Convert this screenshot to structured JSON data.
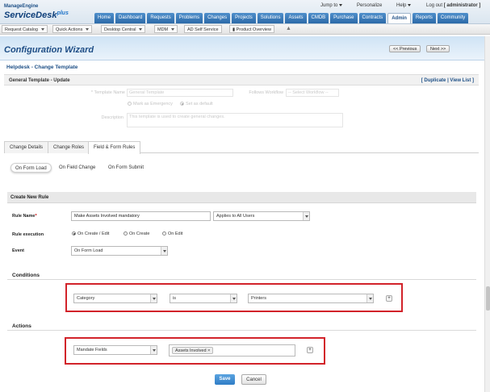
{
  "header": {
    "logo_top": "ManageEngine",
    "logo_main": "ServiceDesk",
    "logo_suffix": "plus",
    "links": {
      "jump_to": "Jump to",
      "personalize": "Personalize",
      "help": "Help",
      "logout": "Log out",
      "user": "[ administrator ]"
    },
    "nav": [
      {
        "label": "Home"
      },
      {
        "label": "Dashboard"
      },
      {
        "label": "Requests"
      },
      {
        "label": "Problems"
      },
      {
        "label": "Changes"
      },
      {
        "label": "Projects"
      },
      {
        "label": "Solutions"
      },
      {
        "label": "Assets"
      },
      {
        "label": "CMDB"
      },
      {
        "label": "Purchase"
      },
      {
        "label": "Contracts"
      },
      {
        "label": "Admin",
        "active": true
      },
      {
        "label": "Reports"
      },
      {
        "label": "Community"
      }
    ]
  },
  "toolbar": {
    "request_catalog": "Request Catalog",
    "quick_actions": "Quick Actions",
    "desktop_central": "Desktop Central",
    "mdm": "MDM",
    "ad_self_service": "AD Self Service",
    "product_overview": "Product Overview"
  },
  "wizard": {
    "title": "Configuration Wizard",
    "previous": "<< Previous",
    "next": "Next >>"
  },
  "breadcrumb": "Helpdesk - Change Template",
  "template_section": {
    "title": "General Template - Update",
    "duplicate": "Duplicate",
    "view_list": "View List",
    "template_name_label": "* Template Name",
    "template_name_value": "General Template",
    "follows_workflow_label": "Follows Workflow",
    "follows_workflow_value": "-- Select Workflow --",
    "mark_emergency": "Mark as Emergency",
    "set_default": "Set as default",
    "description_label": "Description",
    "description_value": "This template is used to create general changes."
  },
  "tabs": [
    {
      "label": "Change Details"
    },
    {
      "label": "Change Roles"
    },
    {
      "label": "Field & Form Rules",
      "active": true
    }
  ],
  "subtabs": [
    {
      "label": "On Form Load",
      "active": true
    },
    {
      "label": "On Field Change"
    },
    {
      "label": "On Form Submit"
    }
  ],
  "rule": {
    "section_title": "Create New Rule",
    "name_label": "Rule Name",
    "name_value": "Make Assets Involved mandatory",
    "applies_value": "Applies to All Users",
    "execution_label": "Rule execution",
    "exec_options": [
      "On Create / Edit",
      "On Create",
      "On Edit"
    ],
    "exec_selected": "On Create / Edit",
    "event_label": "Event",
    "event_value": "On Form Load"
  },
  "conditions": {
    "label": "Conditions",
    "field": "Category",
    "operator": "is",
    "value": "Printers"
  },
  "actions": {
    "label": "Actions",
    "action": "Mandate Fields",
    "target": "Assets Involved"
  },
  "buttons": {
    "save": "Save",
    "cancel": "Cancel"
  },
  "colors": {
    "nav_blue": "#2c6aa8",
    "highlight_red": "#d2232a",
    "save_blue": "#2f7dc6"
  }
}
